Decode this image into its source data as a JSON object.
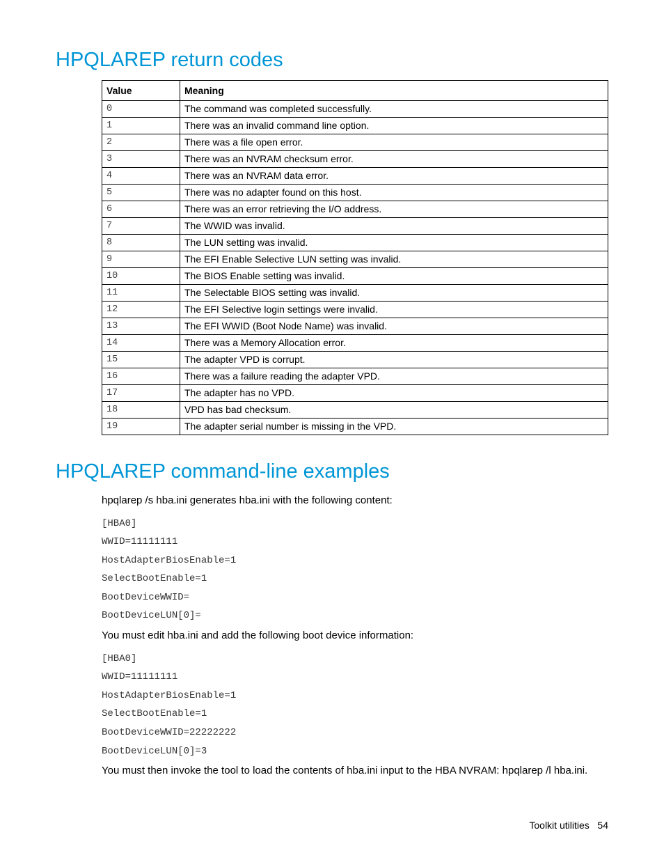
{
  "heading1": "HPQLAREP return codes",
  "table": {
    "headers": {
      "value": "Value",
      "meaning": "Meaning"
    },
    "rows": [
      {
        "v": "0",
        "m": "The command was completed successfully."
      },
      {
        "v": "1",
        "m": "There was an invalid command line option."
      },
      {
        "v": "2",
        "m": "There was a file open error."
      },
      {
        "v": "3",
        "m": "There was an NVRAM checksum error."
      },
      {
        "v": "4",
        "m": "There was an NVRAM data error."
      },
      {
        "v": "5",
        "m": "There was no adapter found on this host."
      },
      {
        "v": "6",
        "m": "There was an error retrieving the I/O address."
      },
      {
        "v": "7",
        "m": "The WWID was invalid."
      },
      {
        "v": "8",
        "m": "The LUN setting was invalid."
      },
      {
        "v": "9",
        "m": "The EFI Enable Selective LUN setting was invalid."
      },
      {
        "v": "10",
        "m": "The BIOS Enable setting was invalid."
      },
      {
        "v": "11",
        "m": "The Selectable BIOS setting was invalid."
      },
      {
        "v": "12",
        "m": "The EFI Selective login settings were invalid."
      },
      {
        "v": "13",
        "m": "The EFI WWID (Boot Node Name) was invalid."
      },
      {
        "v": "14",
        "m": "There was a Memory Allocation error."
      },
      {
        "v": "15",
        "m": "The adapter VPD is corrupt."
      },
      {
        "v": "16",
        "m": "There was a failure reading the adapter VPD."
      },
      {
        "v": "17",
        "m": "The adapter has no VPD."
      },
      {
        "v": "18",
        "m": "VPD has bad checksum."
      },
      {
        "v": "19",
        "m": "The adapter serial number is missing in the VPD."
      }
    ]
  },
  "heading2": "HPQLAREP command-line examples",
  "examples": {
    "intro1": "hpqlarep /s hba.ini generates hba.ini with the following content:",
    "snippet1": [
      "[HBA0]",
      "WWID=11111111",
      "HostAdapterBiosEnable=1",
      "SelectBootEnable=1",
      "BootDeviceWWID=",
      "BootDeviceLUN[0]="
    ],
    "intro2": "You must edit hba.ini and add the following boot device information:",
    "snippet2": [
      "[HBA0]",
      "WWID=11111111",
      "HostAdapterBiosEnable=1",
      "SelectBootEnable=1",
      "BootDeviceWWID=22222222",
      "BootDeviceLUN[0]=3"
    ],
    "outro": "You must then invoke the tool to load the contents of hba.ini input to the HBA NVRAM: hpqlarep /l hba.ini."
  },
  "footer": {
    "label": "Toolkit utilities",
    "page": "54"
  }
}
